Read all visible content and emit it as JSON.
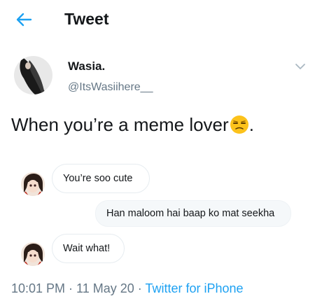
{
  "header": {
    "title": "Tweet",
    "back_icon": "arrow-left-icon",
    "accent": "#1da1f2"
  },
  "author": {
    "display_name": "Wasia.",
    "handle": "@ItsWasiihere__",
    "menu_icon": "chevron-down-icon"
  },
  "tweet": {
    "text": "When you’re a meme lover",
    "emoji": "unamused-face-emoji",
    "suffix": "."
  },
  "conversation": [
    {
      "side": "left",
      "text": "You’re soo cute",
      "avatar": "anime-avatar"
    },
    {
      "side": "right",
      "text": "Han maloom hai baap ko mat seekha"
    },
    {
      "side": "left",
      "text": "Wait what!",
      "avatar": "anime-avatar"
    }
  ],
  "footer": {
    "time": "10:01 PM",
    "sep1": " · ",
    "date": "11 May 20",
    "sep2": " · ",
    "source": "Twitter for iPhone"
  }
}
